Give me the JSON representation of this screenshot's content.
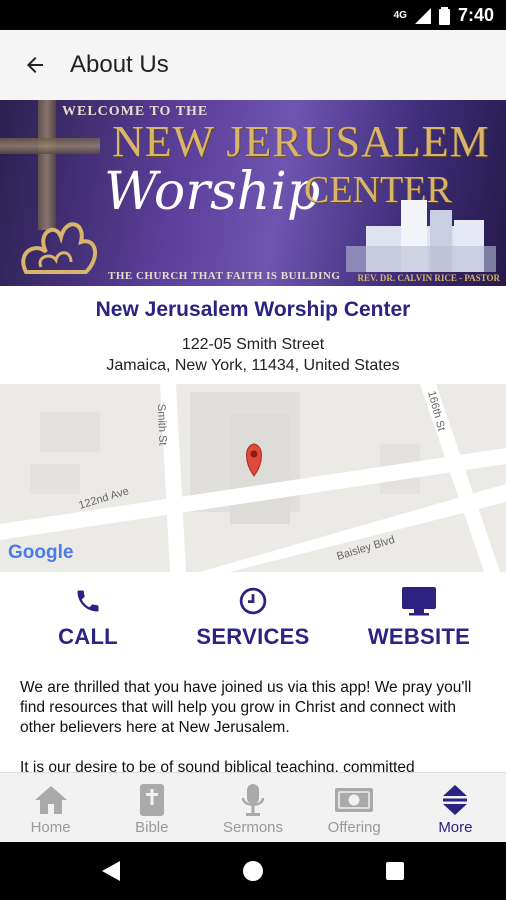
{
  "status_bar": {
    "network": "4G",
    "time": "7:40"
  },
  "app_bar": {
    "title": "About Us",
    "back_icon": "arrow-left-icon"
  },
  "banner": {
    "welcome": "WELCOME TO THE",
    "line1": "NEW JERUSALEM",
    "line2": "Worship",
    "line3": "CENTER",
    "tagline": "THE CHURCH THAT FAITH IS BUILDING",
    "pastor": "REV. DR. CALVIN RICE - PASTOR"
  },
  "church": {
    "name": "New Jerusalem Worship Center",
    "street": "122-05 Smith Street",
    "city": "Jamaica, New York, 11434, United States"
  },
  "map": {
    "streets": [
      "Smith St",
      "122nd Ave",
      "166th St",
      "Baisley Blvd"
    ],
    "attribution": "Google"
  },
  "actions": [
    {
      "label": "CALL",
      "icon": "phone-icon"
    },
    {
      "label": "SERVICES",
      "icon": "clock-icon"
    },
    {
      "label": "WEBSITE",
      "icon": "monitor-icon"
    }
  ],
  "about": {
    "para1": "We are thrilled that you have joined us via this app!  We pray you'll find resources that will help you grow in Christ and connect with other believers here at New Jerusalem.",
    "para2": "It is our desire to be of sound biblical teaching, committed"
  },
  "bottom_nav": [
    {
      "label": "Home",
      "icon": "home-icon",
      "active": false
    },
    {
      "label": "Bible",
      "icon": "bible-icon",
      "active": false
    },
    {
      "label": "Sermons",
      "icon": "microphone-icon",
      "active": false
    },
    {
      "label": "Offering",
      "icon": "money-icon",
      "active": false
    },
    {
      "label": "More",
      "icon": "more-icon",
      "active": true
    }
  ],
  "colors": {
    "accent": "#2d2281",
    "inactive": "#999999"
  }
}
